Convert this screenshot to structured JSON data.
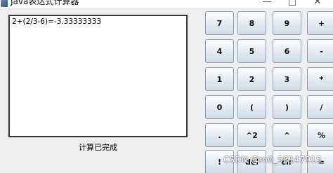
{
  "window": {
    "title": "Java表达式计算器",
    "min_glyph": "—",
    "close_glyph": "✕"
  },
  "display": {
    "text": "2+(2/3-6)=-3.33333333"
  },
  "status": {
    "text": "计算已完成"
  },
  "keys": [
    [
      "7",
      "8",
      "9",
      "+"
    ],
    [
      "4",
      "5",
      "6",
      "-"
    ],
    [
      "1",
      "2",
      "3",
      "*"
    ],
    [
      "0",
      "(",
      ")",
      "/"
    ],
    [
      ".",
      "^2",
      "^",
      "%"
    ],
    [
      "!",
      "del",
      "clr",
      "="
    ]
  ],
  "watermark": "CSDN @m0_58147915"
}
